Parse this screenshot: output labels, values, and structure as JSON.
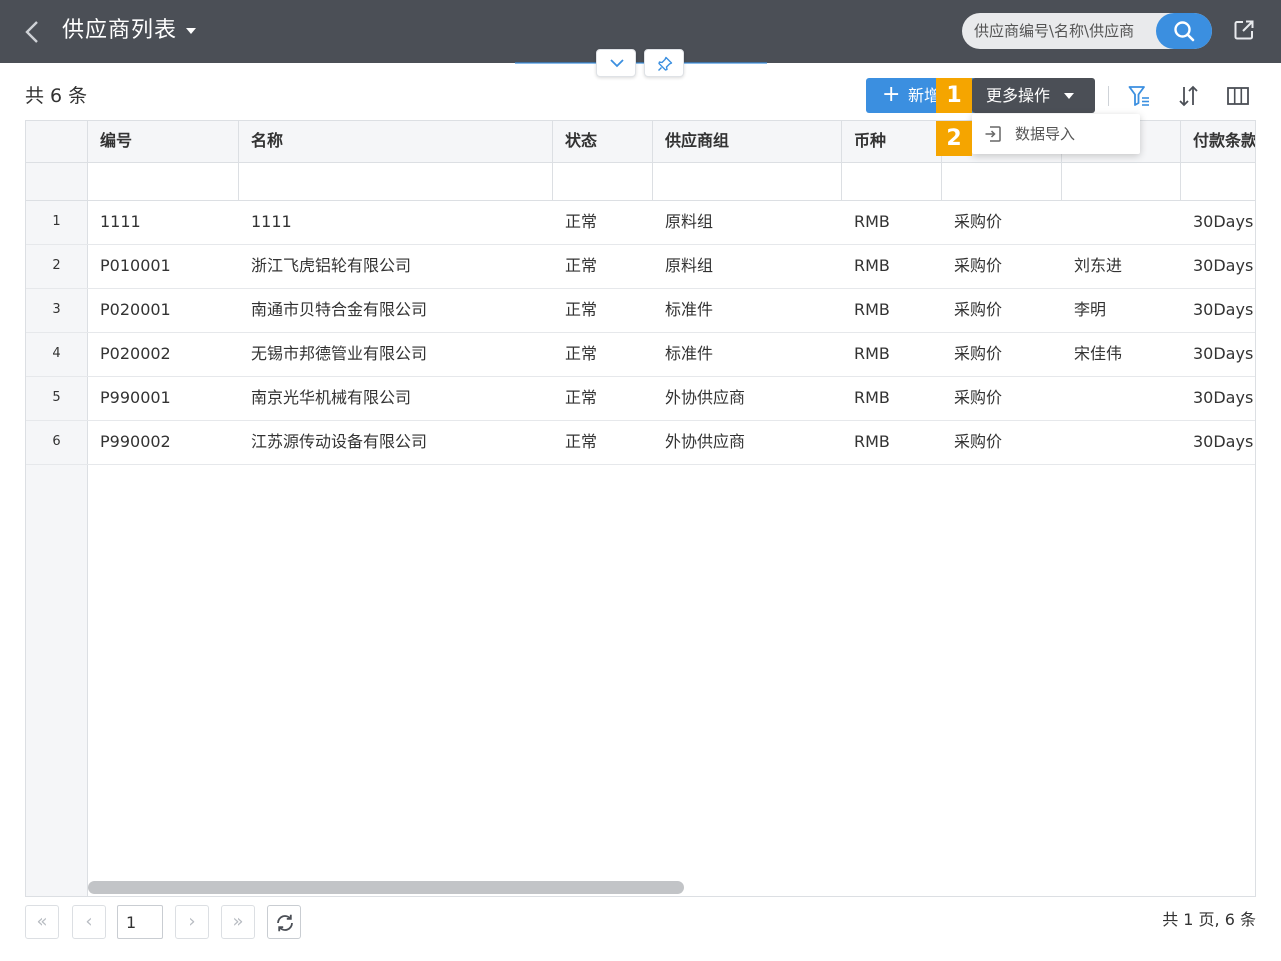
{
  "header": {
    "title": "供应商列表",
    "search_placeholder": "供应商编号\\名称\\供应商"
  },
  "toolbar": {
    "total_label": "共 6 条",
    "add_label": "新增",
    "more_label": "更多操作",
    "badge_1": "1",
    "badge_2": "2"
  },
  "dropdown": {
    "items": [
      {
        "label": "数据导入"
      }
    ]
  },
  "table": {
    "columns": [
      "编号",
      "名称",
      "状态",
      "供应商组",
      "币种",
      "",
      "",
      "付款条款"
    ],
    "rows": [
      {
        "num": "1",
        "code": "1111",
        "name": "1111",
        "status": "正常",
        "group": "原料组",
        "currency": "RMB",
        "price": "采购价",
        "buyer": "",
        "terms": "30Days"
      },
      {
        "num": "2",
        "code": "P010001",
        "name": "浙江飞虎铝轮有限公司",
        "status": "正常",
        "group": "原料组",
        "currency": "RMB",
        "price": "采购价",
        "buyer": "刘东进",
        "terms": "30Days"
      },
      {
        "num": "3",
        "code": "P020001",
        "name": "南通市贝特合金有限公司",
        "status": "正常",
        "group": "标准件",
        "currency": "RMB",
        "price": "采购价",
        "buyer": "李明",
        "terms": "30Days"
      },
      {
        "num": "4",
        "code": "P020002",
        "name": "无锡市邦德管业有限公司",
        "status": "正常",
        "group": "标准件",
        "currency": "RMB",
        "price": "采购价",
        "buyer": "宋佳伟",
        "terms": "30Days"
      },
      {
        "num": "5",
        "code": "P990001",
        "name": "南京光华机械有限公司",
        "status": "正常",
        "group": "外协供应商",
        "currency": "RMB",
        "price": "采购价",
        "buyer": "",
        "terms": "30Days"
      },
      {
        "num": "6",
        "code": "P990002",
        "name": "江苏源传动设备有限公司",
        "status": "正常",
        "group": "外协供应商",
        "currency": "RMB",
        "price": "采购价",
        "buyer": "",
        "terms": "30Days"
      }
    ]
  },
  "pager": {
    "current_page": "1",
    "summary": "共 1 页, 6 条",
    "first": "«",
    "prev": "‹",
    "next": "›",
    "last": "»"
  },
  "colors": {
    "header_bg": "#4b4f56",
    "primary": "#3b8fe0",
    "badge": "#f5a500",
    "link": "#2f74c6"
  }
}
